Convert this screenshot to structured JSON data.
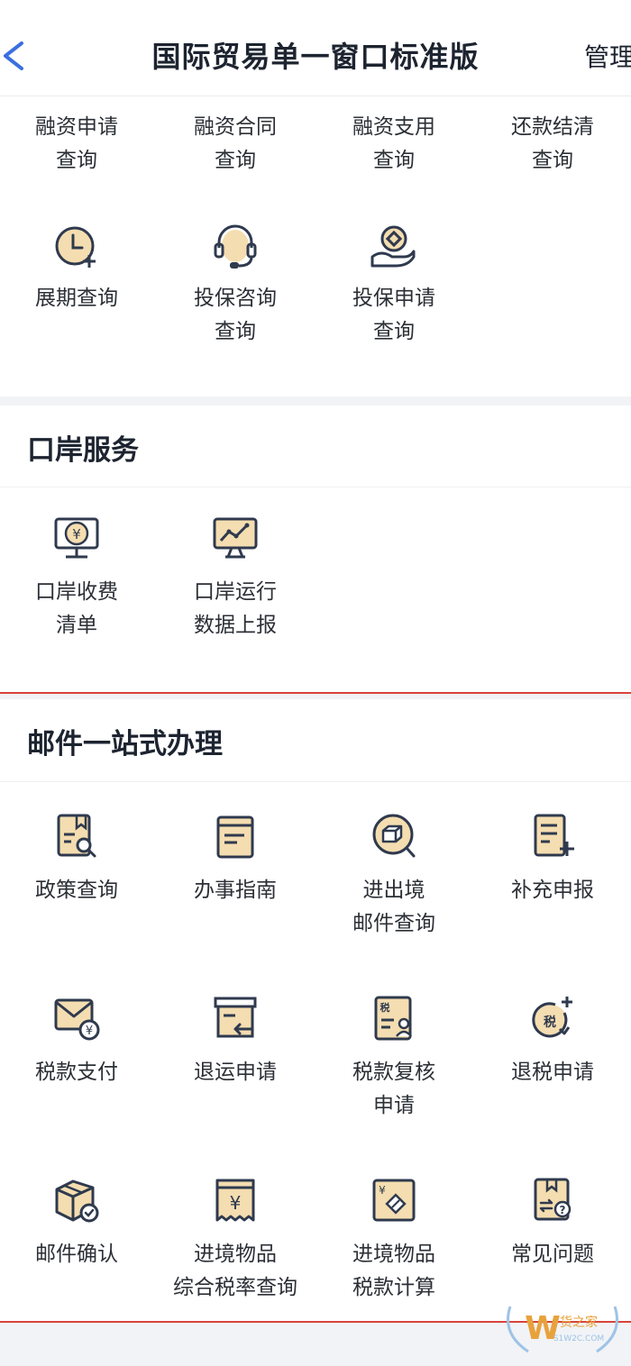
{
  "header": {
    "title": "国际贸易单一窗口标准版",
    "right_label": "管理"
  },
  "finance": {
    "row1": [
      {
        "line1": "融资申请",
        "line2": "查询"
      },
      {
        "line1": "融资合同",
        "line2": "查询"
      },
      {
        "line1": "融资支用",
        "line2": "查询"
      },
      {
        "line1": "还款结清",
        "line2": "查询"
      }
    ],
    "row2": [
      {
        "line1": "展期查询",
        "line2": "",
        "icon": "clock-plus-icon"
      },
      {
        "line1": "投保咨询",
        "line2": "查询",
        "icon": "headset-icon"
      },
      {
        "line1": "投保申请",
        "line2": "查询",
        "icon": "hand-coin-icon"
      }
    ]
  },
  "port": {
    "title": "口岸服务",
    "items": [
      {
        "line1": "口岸收费",
        "line2": "清单",
        "icon": "monitor-yuan-icon"
      },
      {
        "line1": "口岸运行",
        "line2": "数据上报",
        "icon": "monitor-chart-icon"
      }
    ]
  },
  "mail": {
    "title": "邮件一站式办理",
    "items": [
      {
        "line1": "政策查询",
        "line2": "",
        "icon": "document-search-icon"
      },
      {
        "line1": "办事指南",
        "line2": "",
        "icon": "guide-book-icon"
      },
      {
        "line1": "进出境",
        "line2": "邮件查询",
        "icon": "parcel-search-icon"
      },
      {
        "line1": "补充申报",
        "line2": "",
        "icon": "document-add-icon"
      },
      {
        "line1": "税款支付",
        "line2": "",
        "icon": "envelope-yuan-icon"
      },
      {
        "line1": "退运申请",
        "line2": "",
        "icon": "return-box-icon"
      },
      {
        "line1": "税款复核",
        "line2": "申请",
        "icon": "tax-review-icon"
      },
      {
        "line1": "退税申请",
        "line2": "",
        "icon": "tax-refund-icon"
      },
      {
        "line1": "邮件确认",
        "line2": "",
        "icon": "parcel-check-icon"
      },
      {
        "line1": "进境物品",
        "line2": "综合税率查询",
        "icon": "receipt-yuan-icon"
      },
      {
        "line1": "进境物品",
        "line2": "税款计算",
        "icon": "tax-calc-icon"
      },
      {
        "line1": "常见问题",
        "line2": "",
        "icon": "faq-book-icon"
      }
    ]
  },
  "watermark": {
    "brand": "货之家",
    "domain": "S1W2C.COM",
    "letter": "W"
  },
  "colors": {
    "icon_stroke": "#2f3a4e",
    "icon_fill": "#f4ddb0",
    "accent_red": "#d9433b"
  }
}
